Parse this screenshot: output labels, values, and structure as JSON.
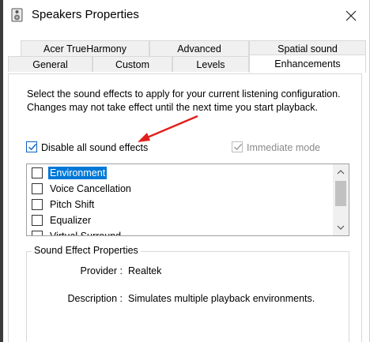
{
  "window": {
    "title": "Speakers Properties"
  },
  "tabs": {
    "row1": [
      "Acer TrueHarmony",
      "Advanced",
      "Spatial sound"
    ],
    "row2": [
      "General",
      "Custom",
      "Levels",
      "Enhancements"
    ],
    "active": "Enhancements"
  },
  "description": "Select the sound effects to apply for your current listening configuration. Changes may not take effect until the next time you start playback.",
  "disable_all": {
    "label": "Disable all sound effects",
    "checked": true
  },
  "immediate_mode": {
    "label": "Immediate mode",
    "checked": true,
    "enabled": false
  },
  "effects": [
    {
      "label": "Environment",
      "checked": false,
      "selected": true
    },
    {
      "label": "Voice Cancellation",
      "checked": false,
      "selected": false
    },
    {
      "label": "Pitch Shift",
      "checked": false,
      "selected": false
    },
    {
      "label": "Equalizer",
      "checked": false,
      "selected": false
    },
    {
      "label": "Virtual Surround",
      "checked": false,
      "selected": false
    }
  ],
  "properties": {
    "group_title": "Sound Effect Properties",
    "provider_label": "Provider :",
    "provider_value": "Realtek",
    "description_label": "Description :",
    "description_value": "Simulates multiple playback environments."
  },
  "colors": {
    "accent": "#0078d7",
    "arrow": "#e0201b"
  }
}
